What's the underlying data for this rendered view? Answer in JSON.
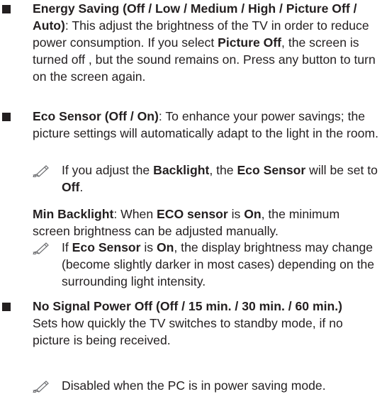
{
  "energy_saving": {
    "title": "Energy Saving (Off / Low / Medium / High / Picture Off / Auto)",
    "desc_1": "This adjust the brightness of the TV in order to reduce power consumption. If you select ",
    "desc_bold": "Picture Off",
    "desc_2": ", the screen is turned off , but the sound remains on. Press any button to turn on the screen again."
  },
  "eco_sensor": {
    "title": "Eco Sensor (Off / On)",
    "desc": "To enhance your power savings; the picture settings will automatically adapt to the light in the room.",
    "note": {
      "t1": "If you adjust the ",
      "b1": "Backlight",
      "t2": ", the ",
      "b2": "Eco Sensor",
      "t3": " will be set to ",
      "b3": "Off",
      "t4": "."
    },
    "min_backlight": {
      "label": "Min Backlight",
      "t1": ": When ",
      "b1": "ECO sensor",
      "t2": " is ",
      "b2": "On",
      "t3": ", the minimum screen brightness can be adjusted manually."
    },
    "note2": {
      "t1": "If ",
      "b1": "Eco Sensor",
      "t2": " is ",
      "b2": "On",
      "t3": ", the display brightness may change (become slightly darker in most cases) depending on the surrounding light intensity."
    }
  },
  "no_signal": {
    "title": "No Signal Power Off  (Off / 15 min. / 30 min. / 60 min.)",
    "desc": "Sets how quickly the TV switches to standby mode, if no picture is being received.",
    "note": "Disabled when the PC is in power saving mode."
  },
  "icons": {
    "bullet": "square-bullet-icon",
    "note": "pencil-note-icon"
  },
  "colors": {
    "text": "#231f20"
  }
}
